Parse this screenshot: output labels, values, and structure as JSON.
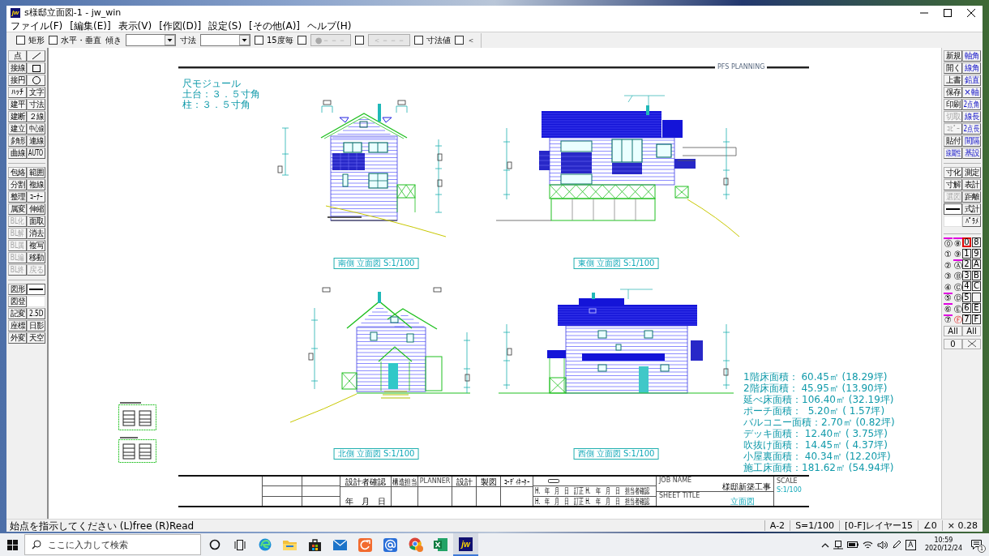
{
  "window": {
    "title": "s様邸立面図-1 - jw_win",
    "logo": "jw"
  },
  "menu": [
    "ファイル(F)",
    "[編集(E)]",
    "表示(V)",
    "[作図(D)]",
    "設定(S)",
    "[その他(A)]",
    "ヘルプ(H)"
  ],
  "toolbar": [
    {
      "kind": "checkbox",
      "label": "矩形",
      "checked": false
    },
    {
      "kind": "checkbox",
      "label": "水平・垂直",
      "checked": false
    },
    {
      "kind": "label",
      "label": "傾き"
    },
    {
      "kind": "combo"
    },
    {
      "kind": "label",
      "label": "寸法"
    },
    {
      "kind": "combo"
    },
    {
      "kind": "checkbox",
      "label": "15度毎",
      "checked": false
    },
    {
      "kind": "checkbox",
      "checked": false
    },
    {
      "kind": "button",
      "label": "●－－－",
      "disabled": true
    },
    {
      "kind": "checkbox",
      "checked": false
    },
    {
      "kind": "button",
      "label": "＜－－－",
      "disabled": true
    },
    {
      "kind": "checkbox",
      "label": "寸法値",
      "checked": false
    },
    {
      "kind": "checkbox",
      "label": "＜",
      "checked": false
    }
  ],
  "left_tools": [
    [
      {
        "kind": "text",
        "label": "点",
        "disabled": false
      },
      {
        "kind": "line",
        "disabled": false
      },
      {
        "kind": "text",
        "label": "接線",
        "disabled": false
      },
      {
        "kind": "rect",
        "disabled": false
      },
      {
        "kind": "text",
        "label": "接円",
        "disabled": false
      },
      {
        "kind": "circle",
        "disabled": false
      },
      {
        "kind": "text",
        "label": "ﾊｯﾁ",
        "disabled": false
      },
      {
        "kind": "text",
        "label": "文字",
        "disabled": false
      },
      {
        "kind": "text",
        "label": "建平",
        "disabled": false
      },
      {
        "kind": "text",
        "label": "寸法",
        "disabled": false
      },
      {
        "kind": "text",
        "label": "建断",
        "disabled": false
      },
      {
        "kind": "text",
        "label": "２線",
        "disabled": false
      },
      {
        "kind": "text",
        "label": "建立",
        "disabled": false
      },
      {
        "kind": "text",
        "label": "中心線",
        "disabled": false
      },
      {
        "kind": "text",
        "label": "多角形",
        "disabled": false
      },
      {
        "kind": "text",
        "label": "連線",
        "disabled": false
      },
      {
        "kind": "text",
        "label": "曲線",
        "disabled": false
      },
      {
        "kind": "text",
        "label": "AUTO",
        "disabled": false
      }
    ],
    [
      {
        "kind": "text",
        "label": "包絡",
        "disabled": false
      },
      {
        "kind": "text",
        "label": "範囲",
        "disabled": false
      },
      {
        "kind": "text",
        "label": "分割",
        "disabled": false
      },
      {
        "kind": "text",
        "label": "複線",
        "disabled": false
      },
      {
        "kind": "text",
        "label": "整理",
        "disabled": false
      },
      {
        "kind": "text",
        "label": "ｺｰﾅｰ",
        "disabled": false
      },
      {
        "kind": "text",
        "label": "属変",
        "disabled": false
      },
      {
        "kind": "text",
        "label": "伸縮",
        "disabled": false
      },
      {
        "kind": "text",
        "label": "BL化",
        "disabled": true
      },
      {
        "kind": "text",
        "label": "面取",
        "disabled": false
      },
      {
        "kind": "text",
        "label": "BL解",
        "disabled": true
      },
      {
        "kind": "text",
        "label": "消去",
        "disabled": false
      },
      {
        "kind": "text",
        "label": "BL属",
        "disabled": true
      },
      {
        "kind": "text",
        "label": "複写",
        "disabled": false
      },
      {
        "kind": "text",
        "label": "BL編",
        "disabled": true
      },
      {
        "kind": "text",
        "label": "移動",
        "disabled": false
      },
      {
        "kind": "text",
        "label": "BL終",
        "disabled": true
      },
      {
        "kind": "text",
        "label": "戻る",
        "disabled": true
      }
    ],
    [
      {
        "kind": "text",
        "label": "図形",
        "disabled": false
      },
      {
        "kind": "linetype"
      },
      {
        "kind": "text",
        "label": "図登",
        "disabled": false
      },
      {
        "kind": "blank"
      },
      {
        "kind": "text",
        "label": "記変",
        "disabled": false
      },
      {
        "kind": "text",
        "label": "2.5D",
        "disabled": false
      },
      {
        "kind": "text",
        "label": "座標",
        "disabled": false
      },
      {
        "kind": "text",
        "label": "日影",
        "disabled": false
      },
      {
        "kind": "text",
        "label": "外変",
        "disabled": false
      },
      {
        "kind": "text",
        "label": "天空",
        "disabled": false
      }
    ]
  ],
  "right_tools": [
    [
      {
        "kind": "text",
        "label": "新規",
        "disabled": false,
        "accent": false
      },
      {
        "kind": "text",
        "label": "軸角",
        "disabled": false,
        "accent": true
      },
      {
        "kind": "text",
        "label": "開く",
        "disabled": false,
        "accent": false
      },
      {
        "kind": "text",
        "label": "線角",
        "disabled": false,
        "accent": true
      },
      {
        "kind": "text",
        "label": "上書",
        "disabled": false,
        "accent": false
      },
      {
        "kind": "text",
        "label": "鉛直",
        "disabled": false,
        "accent": true
      },
      {
        "kind": "text",
        "label": "保存",
        "disabled": false,
        "accent": false
      },
      {
        "kind": "text",
        "label": "×軸",
        "disabled": false,
        "accent": true
      },
      {
        "kind": "text",
        "label": "印刷",
        "disabled": false,
        "accent": false
      },
      {
        "kind": "text",
        "label": "2点角",
        "disabled": false,
        "accent": true
      },
      {
        "kind": "text",
        "label": "切取",
        "disabled": true
      },
      {
        "kind": "text",
        "label": "線長",
        "disabled": false,
        "accent": true
      },
      {
        "kind": "text",
        "label": "ｺﾋﾟｰ",
        "disabled": true
      },
      {
        "kind": "text",
        "label": "2点長",
        "disabled": false,
        "accent": true
      },
      {
        "kind": "text",
        "label": "貼付",
        "disabled": false,
        "accent": false
      },
      {
        "kind": "text",
        "label": "間隔",
        "disabled": false,
        "accent": true
      },
      {
        "kind": "text",
        "label": "線属性",
        "disabled": false,
        "accent": true
      },
      {
        "kind": "text",
        "label": "基設",
        "disabled": false,
        "accent": true
      }
    ],
    [
      {
        "kind": "text",
        "label": "寸化",
        "disabled": false,
        "accent": false
      },
      {
        "kind": "text",
        "label": "測定",
        "disabled": false,
        "accent": false
      },
      {
        "kind": "text",
        "label": "寸解",
        "disabled": false,
        "accent": false
      },
      {
        "kind": "text",
        "label": "表計",
        "disabled": false,
        "accent": false
      },
      {
        "kind": "text",
        "label": "選図",
        "disabled": true
      },
      {
        "kind": "text",
        "label": "距離",
        "disabled": false,
        "accent": false
      },
      {
        "kind": "linetype"
      },
      {
        "kind": "text",
        "label": "式計",
        "disabled": false,
        "accent": false
      },
      {
        "kind": "blank"
      },
      {
        "kind": "text",
        "label": "ﾊﾟﾗﾒ",
        "disabled": false,
        "accent": false
      }
    ]
  ],
  "layer_panel": {
    "layers": [
      {
        "label": "⓪",
        "used": true,
        "selected": false
      },
      {
        "label": "⑧",
        "used": true,
        "selected": false
      },
      {
        "label": "①",
        "used": false,
        "selected": false
      },
      {
        "label": "⑨",
        "used": false,
        "selected": false
      },
      {
        "label": "②",
        "used": false,
        "selected": false
      },
      {
        "label": "Ⓐ",
        "used": true,
        "selected": false
      },
      {
        "label": "③",
        "used": false,
        "selected": false
      },
      {
        "label": "Ⓑ",
        "used": false,
        "selected": false
      },
      {
        "label": "④",
        "used": false,
        "selected": false
      },
      {
        "label": "Ⓒ",
        "used": false,
        "selected": false
      },
      {
        "label": "⑤",
        "used": true,
        "selected": false
      },
      {
        "label": "Ⓓ",
        "used": false,
        "selected": false
      },
      {
        "label": "⑥",
        "used": true,
        "selected": false
      },
      {
        "label": "Ⓔ",
        "used": false,
        "selected": false
      },
      {
        "label": "⑦",
        "used": true,
        "selected": false
      },
      {
        "label": "Ⓕ",
        "used": false,
        "selected": true
      }
    ],
    "layer_extra": [
      "All",
      "0"
    ],
    "groups": [
      {
        "kind": "group",
        "label": "0",
        "selected": true
      },
      {
        "kind": "group",
        "label": "8",
        "selected": false
      },
      {
        "kind": "group",
        "label": "1",
        "selected": false
      },
      {
        "kind": "group",
        "label": "9",
        "selected": false
      },
      {
        "kind": "group",
        "label": "2",
        "selected": false
      },
      {
        "kind": "group",
        "label": "A",
        "selected": false
      },
      {
        "kind": "group",
        "label": "3",
        "selected": false
      },
      {
        "kind": "group",
        "label": "B",
        "selected": false
      },
      {
        "kind": "group",
        "label": "4",
        "selected": false
      },
      {
        "kind": "group",
        "label": "C",
        "selected": false
      },
      {
        "kind": "group",
        "label": "5",
        "selected": false
      },
      {
        "kind": "empty"
      },
      {
        "kind": "group",
        "label": "6",
        "selected": false
      },
      {
        "kind": "group",
        "label": "E",
        "selected": false
      },
      {
        "kind": "group",
        "label": "7",
        "selected": false
      },
      {
        "kind": "group",
        "label": "F",
        "selected": false
      }
    ],
    "group_extra": [
      {
        "kind": "text",
        "label": "All"
      },
      {
        "kind": "cross"
      }
    ]
  },
  "sheet": {
    "header": "PFS PLANNING",
    "notes": [
      "尺モジュール",
      "土台：３．５寸角",
      "柱：３．５寸角"
    ],
    "elevations": [
      {
        "kind": "south",
        "caption": "南側 立面図 S:1/100"
      },
      {
        "kind": "east",
        "caption": "東側 立面図 S:1/100"
      },
      {
        "kind": "north",
        "caption": "北側 立面図 S:1/100"
      },
      {
        "kind": "west",
        "caption": "西側 立面図 S:1/100"
      }
    ],
    "area_table": [
      "1階床面積： 60.45㎡ (18.29坪)",
      "2階床面積： 45.95㎡ (13.90坪)",
      "延べ床面積：106.40㎡ (32.19坪)",
      "ポーチ面積：  5.20㎡ ( 1.57坪)",
      "バルコニー面積：2.70㎡ (0.82坪)",
      "デッキ面積： 12.40㎡ ( 3.75坪)",
      "吹抜け面積： 14.45㎡ ( 4.37坪)",
      "小屋裏面積： 40.34㎡ (12.20坪)",
      "施工床面積：181.62㎡ (54.94坪)"
    ],
    "title_block": {
      "headers": [
        "設計者確認",
        "構造担当",
        "PLANNER",
        "設計",
        "製図",
        "ｺｰﾃﾞｨﾈｰﾀｰ"
      ],
      "date": "年　月　日",
      "revisions": [
        "H.　年　月　日　訂正 H.　年　月　日　担当者確認",
        "H.　年　月　日　訂正 H.　年　月　日　担当者確認"
      ],
      "job_label": "JOB NAME",
      "job_name": "様邸新築工事",
      "sheet_label": "SHEET TITLE",
      "sheet_title": "立面図",
      "scale_label": "SCALE",
      "scale": "S:1/100"
    }
  },
  "status_bar": {
    "prompt": "始点を指示してください (L)free (R)Read",
    "fields": [
      "A-2",
      "S=1/100",
      "[0-F]レイヤー15",
      "∠0",
      "× 0.28"
    ]
  },
  "taskbar": {
    "search": {
      "placeholder": "ここに入力して検索"
    },
    "apps": [
      {
        "kind": "cortana",
        "selected": false
      },
      {
        "kind": "taskview",
        "selected": false
      },
      {
        "kind": "edge",
        "selected": false
      },
      {
        "kind": "explorer",
        "selected": false
      },
      {
        "kind": "store",
        "selected": false
      },
      {
        "kind": "mail",
        "selected": false
      },
      {
        "kind": "orange",
        "selected": false
      },
      {
        "kind": "at",
        "selected": false
      },
      {
        "kind": "chrome",
        "selected": false
      },
      {
        "kind": "excel",
        "selected": false
      },
      {
        "kind": "jw",
        "selected": true,
        "logo": "jw"
      }
    ],
    "tray": {
      "ime": "A",
      "time": "10:59",
      "date": "2020/12/24",
      "notifications": "1"
    }
  }
}
